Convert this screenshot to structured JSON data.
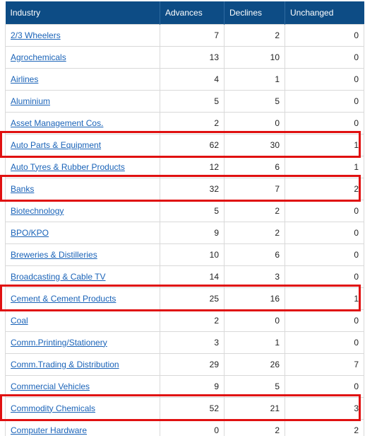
{
  "table": {
    "columns": [
      "Industry",
      "Advances",
      "Declines",
      "Unchanged"
    ],
    "rows": [
      {
        "industry": "2/3 Wheelers",
        "advances": "7",
        "declines": "2",
        "unchanged": "0"
      },
      {
        "industry": "Agrochemicals",
        "advances": "13",
        "declines": "10",
        "unchanged": "0"
      },
      {
        "industry": "Airlines",
        "advances": "4",
        "declines": "1",
        "unchanged": "0"
      },
      {
        "industry": "Aluminium",
        "advances": "5",
        "declines": "5",
        "unchanged": "0"
      },
      {
        "industry": "Asset Management Cos.",
        "advances": "2",
        "declines": "0",
        "unchanged": "0"
      },
      {
        "industry": "Auto Parts & Equipment",
        "advances": "62",
        "declines": "30",
        "unchanged": "1"
      },
      {
        "industry": "Auto Tyres & Rubber Products",
        "advances": "12",
        "declines": "6",
        "unchanged": "1"
      },
      {
        "industry": "Banks",
        "advances": "32",
        "declines": "7",
        "unchanged": "2"
      },
      {
        "industry": "Biotechnology",
        "advances": "5",
        "declines": "2",
        "unchanged": "0"
      },
      {
        "industry": "BPO/KPO",
        "advances": "9",
        "declines": "2",
        "unchanged": "0"
      },
      {
        "industry": "Breweries & Distilleries",
        "advances": "10",
        "declines": "6",
        "unchanged": "0"
      },
      {
        "industry": "Broadcasting & Cable TV",
        "advances": "14",
        "declines": "3",
        "unchanged": "0"
      },
      {
        "industry": "Cement & Cement Products",
        "advances": "25",
        "declines": "16",
        "unchanged": "1"
      },
      {
        "industry": "Coal",
        "advances": "2",
        "declines": "0",
        "unchanged": "0"
      },
      {
        "industry": "Comm.Printing/Stationery",
        "advances": "3",
        "declines": "1",
        "unchanged": "0"
      },
      {
        "industry": "Comm.Trading & Distribution",
        "advances": "29",
        "declines": "26",
        "unchanged": "7"
      },
      {
        "industry": "Commercial Vehicles",
        "advances": "9",
        "declines": "5",
        "unchanged": "0"
      },
      {
        "industry": "Commodity Chemicals",
        "advances": "52",
        "declines": "21",
        "unchanged": "3"
      },
      {
        "industry": "Computer Hardware",
        "advances": "0",
        "declines": "2",
        "unchanged": "2"
      }
    ]
  },
  "highlighted_rows": [
    "Auto Parts & Equipment",
    "Banks",
    "Cement & Cement Products",
    "Commodity Chemicals"
  ],
  "colors": {
    "header_bg": "#0d4c85",
    "link": "#1a63b8",
    "highlight_border": "#e01010"
  }
}
